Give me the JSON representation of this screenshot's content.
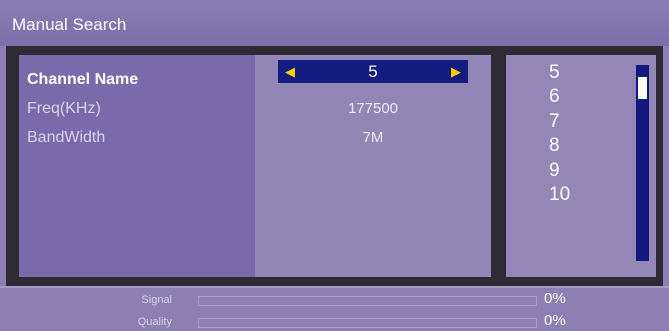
{
  "title": "Manual Search",
  "settings": [
    {
      "label": "Channel Name",
      "value": "5"
    },
    {
      "label": "Freq(KHz)",
      "value": "177500"
    },
    {
      "label": "BandWidth",
      "value": "7M"
    }
  ],
  "channel_list": [
    "5",
    "6",
    "7",
    "8",
    "9",
    "10"
  ],
  "scrollbar": {
    "position_fraction": 0.0
  },
  "signal": {
    "label": "Signal",
    "value": "0%",
    "level": 0
  },
  "quality": {
    "label": "Quality",
    "value": "0%",
    "level": 0
  },
  "colors": {
    "accent_blue": "#151b80",
    "arrow_yellow": "#f3d200",
    "background": "#8d7fb4"
  },
  "icons": {
    "left": "arrow-left-icon",
    "right": "arrow-right-icon"
  }
}
